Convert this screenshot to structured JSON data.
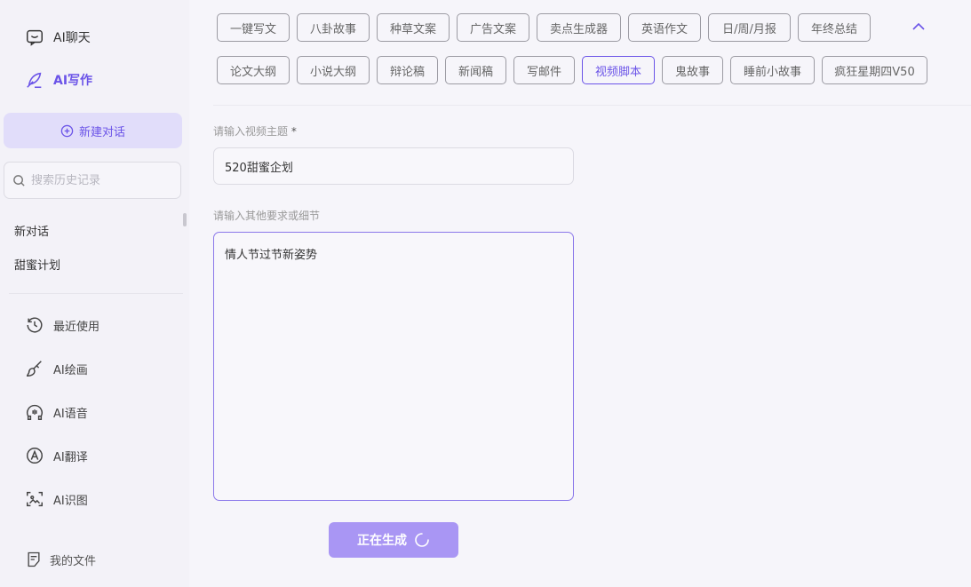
{
  "sidebar": {
    "chat_label": "AI聊天",
    "write_label": "AI写作",
    "new_chat_label": "新建对话",
    "search_placeholder": "搜索历史记录",
    "history": [
      "新对话",
      "甜蜜计划"
    ],
    "tools": [
      {
        "label": "最近使用",
        "icon": "clock-icon"
      },
      {
        "label": "AI绘画",
        "icon": "brush-icon"
      },
      {
        "label": "AI语音",
        "icon": "voice-icon"
      },
      {
        "label": "AI翻译",
        "icon": "translate-icon"
      },
      {
        "label": "AI识图",
        "icon": "scan-image-icon"
      }
    ],
    "files_label": "我的文件"
  },
  "tags": {
    "row1": [
      "一键写文",
      "八卦故事",
      "种草文案",
      "广告文案",
      "卖点生成器",
      "英语作文",
      "日/周/月报",
      "年终总结"
    ],
    "row2": [
      "论文大纲",
      "小说大纲",
      "辩论稿",
      "新闻稿",
      "写邮件",
      "视频脚本",
      "鬼故事",
      "睡前小故事",
      "疯狂星期四V50"
    ],
    "active": "视频脚本"
  },
  "form": {
    "topic_label": "请输入视频主题",
    "required_mark": "*",
    "topic_value": "520甜蜜企划",
    "detail_label": "请输入其他要求或细节",
    "detail_value": "情人节过节新姿势",
    "generate_label": "正在生成"
  },
  "colors": {
    "accent": "#6b54e8",
    "button_bg": "#a996f4",
    "new_chat_bg": "#e1ddfa",
    "page_bg": "#f6f5fa"
  }
}
